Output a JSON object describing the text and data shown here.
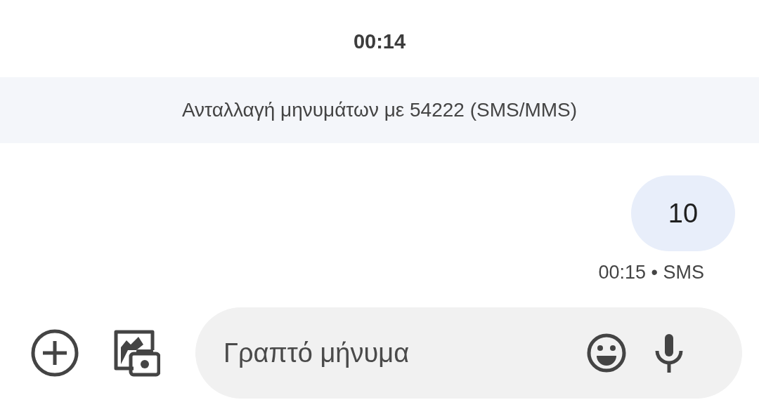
{
  "date_header": "00:14",
  "conversation_banner": "Ανταλλαγή μηνυμάτων με 54222 (SMS/MMS)",
  "messages": [
    {
      "text": "10",
      "meta": "00:15 • SMS"
    }
  ],
  "composer": {
    "placeholder": "Γραπτό μήνυμα"
  }
}
